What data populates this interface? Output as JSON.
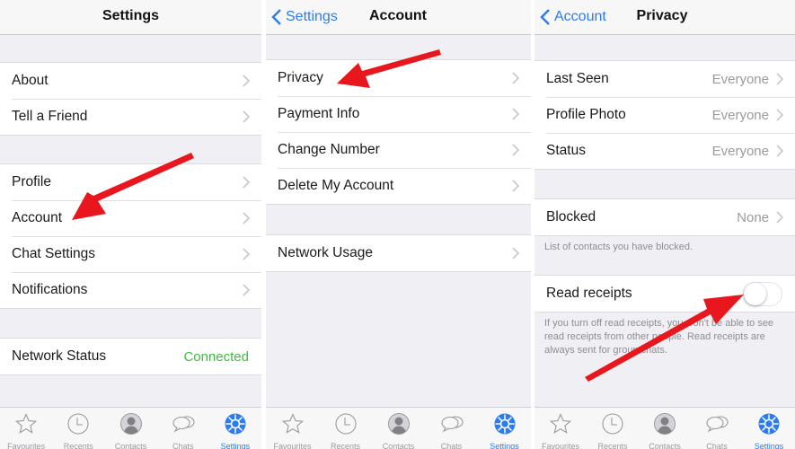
{
  "colors": {
    "accent": "#2d7bf0",
    "connected": "#3cbf3c",
    "arrow": "#e8161d"
  },
  "tabbar": {
    "items": [
      {
        "label": "Favourites",
        "icon": "star-icon"
      },
      {
        "label": "Recents",
        "icon": "clock-icon"
      },
      {
        "label": "Contacts",
        "icon": "contact-icon"
      },
      {
        "label": "Chats",
        "icon": "chat-bubbles-icon"
      },
      {
        "label": "Settings",
        "icon": "gear-icon",
        "active": true
      }
    ]
  },
  "settings": {
    "title": "Settings",
    "group1": [
      {
        "label": "About"
      },
      {
        "label": "Tell a Friend"
      }
    ],
    "group2": [
      {
        "label": "Profile"
      },
      {
        "label": "Account"
      },
      {
        "label": "Chat Settings"
      },
      {
        "label": "Notifications"
      }
    ],
    "network": {
      "label": "Network Status",
      "value": "Connected"
    }
  },
  "account": {
    "back": "Settings",
    "title": "Account",
    "group1": [
      {
        "label": "Privacy"
      },
      {
        "label": "Payment Info"
      },
      {
        "label": "Change Number"
      },
      {
        "label": "Delete My Account"
      }
    ],
    "group2": [
      {
        "label": "Network Usage"
      }
    ]
  },
  "privacy": {
    "back": "Account",
    "title": "Privacy",
    "group1": [
      {
        "label": "Last Seen",
        "value": "Everyone"
      },
      {
        "label": "Profile Photo",
        "value": "Everyone"
      },
      {
        "label": "Status",
        "value": "Everyone"
      }
    ],
    "blocked": {
      "label": "Blocked",
      "value": "None",
      "footnote": "List of contacts you have blocked."
    },
    "read_receipts": {
      "label": "Read receipts",
      "enabled": false,
      "footnote": "If you turn off read receipts, you won't be able to see read receipts from other people. Read receipts are always sent for group chats."
    }
  }
}
